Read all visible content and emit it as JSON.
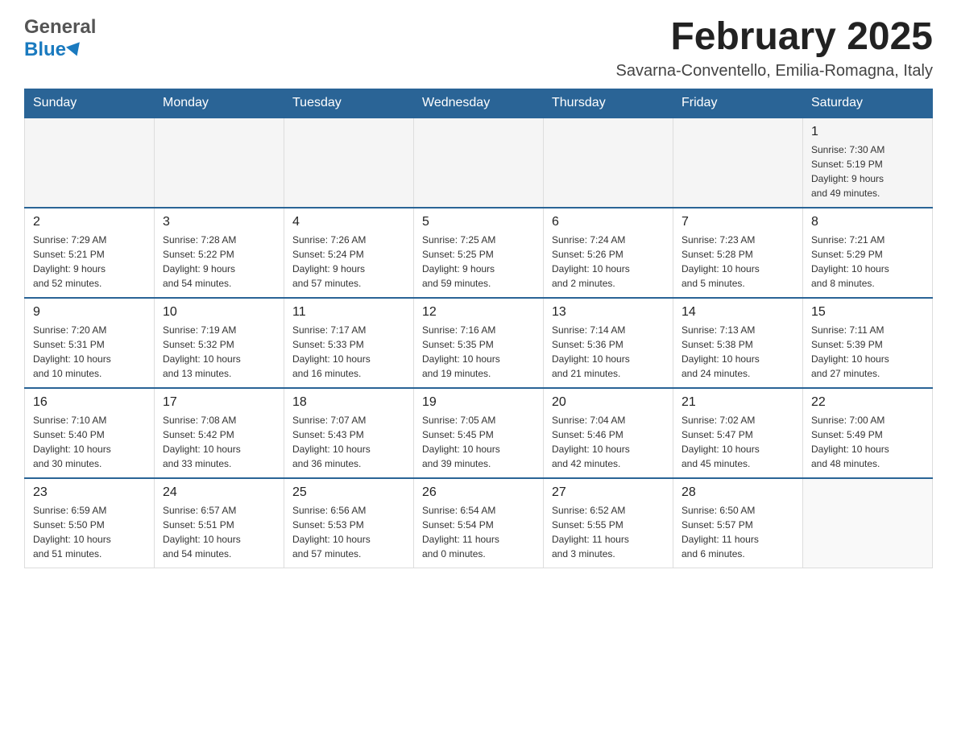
{
  "header": {
    "logo_line1": "General",
    "logo_line2": "Blue",
    "title": "February 2025",
    "location": "Savarna-Conventello, Emilia-Romagna, Italy"
  },
  "days_of_week": [
    "Sunday",
    "Monday",
    "Tuesday",
    "Wednesday",
    "Thursday",
    "Friday",
    "Saturday"
  ],
  "weeks": [
    [
      {
        "day": "",
        "info": ""
      },
      {
        "day": "",
        "info": ""
      },
      {
        "day": "",
        "info": ""
      },
      {
        "day": "",
        "info": ""
      },
      {
        "day": "",
        "info": ""
      },
      {
        "day": "",
        "info": ""
      },
      {
        "day": "1",
        "info": "Sunrise: 7:30 AM\nSunset: 5:19 PM\nDaylight: 9 hours\nand 49 minutes."
      }
    ],
    [
      {
        "day": "2",
        "info": "Sunrise: 7:29 AM\nSunset: 5:21 PM\nDaylight: 9 hours\nand 52 minutes."
      },
      {
        "day": "3",
        "info": "Sunrise: 7:28 AM\nSunset: 5:22 PM\nDaylight: 9 hours\nand 54 minutes."
      },
      {
        "day": "4",
        "info": "Sunrise: 7:26 AM\nSunset: 5:24 PM\nDaylight: 9 hours\nand 57 minutes."
      },
      {
        "day": "5",
        "info": "Sunrise: 7:25 AM\nSunset: 5:25 PM\nDaylight: 9 hours\nand 59 minutes."
      },
      {
        "day": "6",
        "info": "Sunrise: 7:24 AM\nSunset: 5:26 PM\nDaylight: 10 hours\nand 2 minutes."
      },
      {
        "day": "7",
        "info": "Sunrise: 7:23 AM\nSunset: 5:28 PM\nDaylight: 10 hours\nand 5 minutes."
      },
      {
        "day": "8",
        "info": "Sunrise: 7:21 AM\nSunset: 5:29 PM\nDaylight: 10 hours\nand 8 minutes."
      }
    ],
    [
      {
        "day": "9",
        "info": "Sunrise: 7:20 AM\nSunset: 5:31 PM\nDaylight: 10 hours\nand 10 minutes."
      },
      {
        "day": "10",
        "info": "Sunrise: 7:19 AM\nSunset: 5:32 PM\nDaylight: 10 hours\nand 13 minutes."
      },
      {
        "day": "11",
        "info": "Sunrise: 7:17 AM\nSunset: 5:33 PM\nDaylight: 10 hours\nand 16 minutes."
      },
      {
        "day": "12",
        "info": "Sunrise: 7:16 AM\nSunset: 5:35 PM\nDaylight: 10 hours\nand 19 minutes."
      },
      {
        "day": "13",
        "info": "Sunrise: 7:14 AM\nSunset: 5:36 PM\nDaylight: 10 hours\nand 21 minutes."
      },
      {
        "day": "14",
        "info": "Sunrise: 7:13 AM\nSunset: 5:38 PM\nDaylight: 10 hours\nand 24 minutes."
      },
      {
        "day": "15",
        "info": "Sunrise: 7:11 AM\nSunset: 5:39 PM\nDaylight: 10 hours\nand 27 minutes."
      }
    ],
    [
      {
        "day": "16",
        "info": "Sunrise: 7:10 AM\nSunset: 5:40 PM\nDaylight: 10 hours\nand 30 minutes."
      },
      {
        "day": "17",
        "info": "Sunrise: 7:08 AM\nSunset: 5:42 PM\nDaylight: 10 hours\nand 33 minutes."
      },
      {
        "day": "18",
        "info": "Sunrise: 7:07 AM\nSunset: 5:43 PM\nDaylight: 10 hours\nand 36 minutes."
      },
      {
        "day": "19",
        "info": "Sunrise: 7:05 AM\nSunset: 5:45 PM\nDaylight: 10 hours\nand 39 minutes."
      },
      {
        "day": "20",
        "info": "Sunrise: 7:04 AM\nSunset: 5:46 PM\nDaylight: 10 hours\nand 42 minutes."
      },
      {
        "day": "21",
        "info": "Sunrise: 7:02 AM\nSunset: 5:47 PM\nDaylight: 10 hours\nand 45 minutes."
      },
      {
        "day": "22",
        "info": "Sunrise: 7:00 AM\nSunset: 5:49 PM\nDaylight: 10 hours\nand 48 minutes."
      }
    ],
    [
      {
        "day": "23",
        "info": "Sunrise: 6:59 AM\nSunset: 5:50 PM\nDaylight: 10 hours\nand 51 minutes."
      },
      {
        "day": "24",
        "info": "Sunrise: 6:57 AM\nSunset: 5:51 PM\nDaylight: 10 hours\nand 54 minutes."
      },
      {
        "day": "25",
        "info": "Sunrise: 6:56 AM\nSunset: 5:53 PM\nDaylight: 10 hours\nand 57 minutes."
      },
      {
        "day": "26",
        "info": "Sunrise: 6:54 AM\nSunset: 5:54 PM\nDaylight: 11 hours\nand 0 minutes."
      },
      {
        "day": "27",
        "info": "Sunrise: 6:52 AM\nSunset: 5:55 PM\nDaylight: 11 hours\nand 3 minutes."
      },
      {
        "day": "28",
        "info": "Sunrise: 6:50 AM\nSunset: 5:57 PM\nDaylight: 11 hours\nand 6 minutes."
      },
      {
        "day": "",
        "info": ""
      }
    ]
  ]
}
